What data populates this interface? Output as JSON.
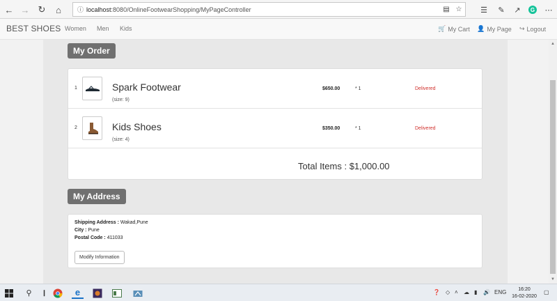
{
  "browser": {
    "url_host": "localhost",
    "url_rest": ":8080/OnlineFootwearShopping/MyPageController"
  },
  "navbar": {
    "brand": "BEST SHOES",
    "links": [
      "Women",
      "Men",
      "Kids"
    ],
    "cart": "My Cart",
    "mypage": "My Page",
    "logout": "Logout"
  },
  "order": {
    "title": "My Order",
    "items": [
      {
        "index": "1",
        "name": "Spark Footwear",
        "size": "(size: 9)",
        "price": "$650.00",
        "qty": "* 1",
        "status": "Delivered"
      },
      {
        "index": "2",
        "name": "Kids Shoes",
        "size": "(size: 4)",
        "price": "$350.00",
        "qty": "* 1",
        "status": "Delivered"
      }
    ],
    "total": "Total Items : $1,000.00"
  },
  "address": {
    "title": "My Address",
    "shipping_label": "Shipping Address :",
    "shipping_value": "Wakad,Pune",
    "city_label": "City :",
    "city_value": "Pune",
    "postal_label": "Postal Code :",
    "postal_value": "411033",
    "modify_button": "Modify Information"
  },
  "taskbar": {
    "lang": "ENG",
    "time": "16:20",
    "date": "16-02-2020"
  },
  "colors": {
    "status_delivered": "#d0312d",
    "section_title_bg": "#707070"
  }
}
